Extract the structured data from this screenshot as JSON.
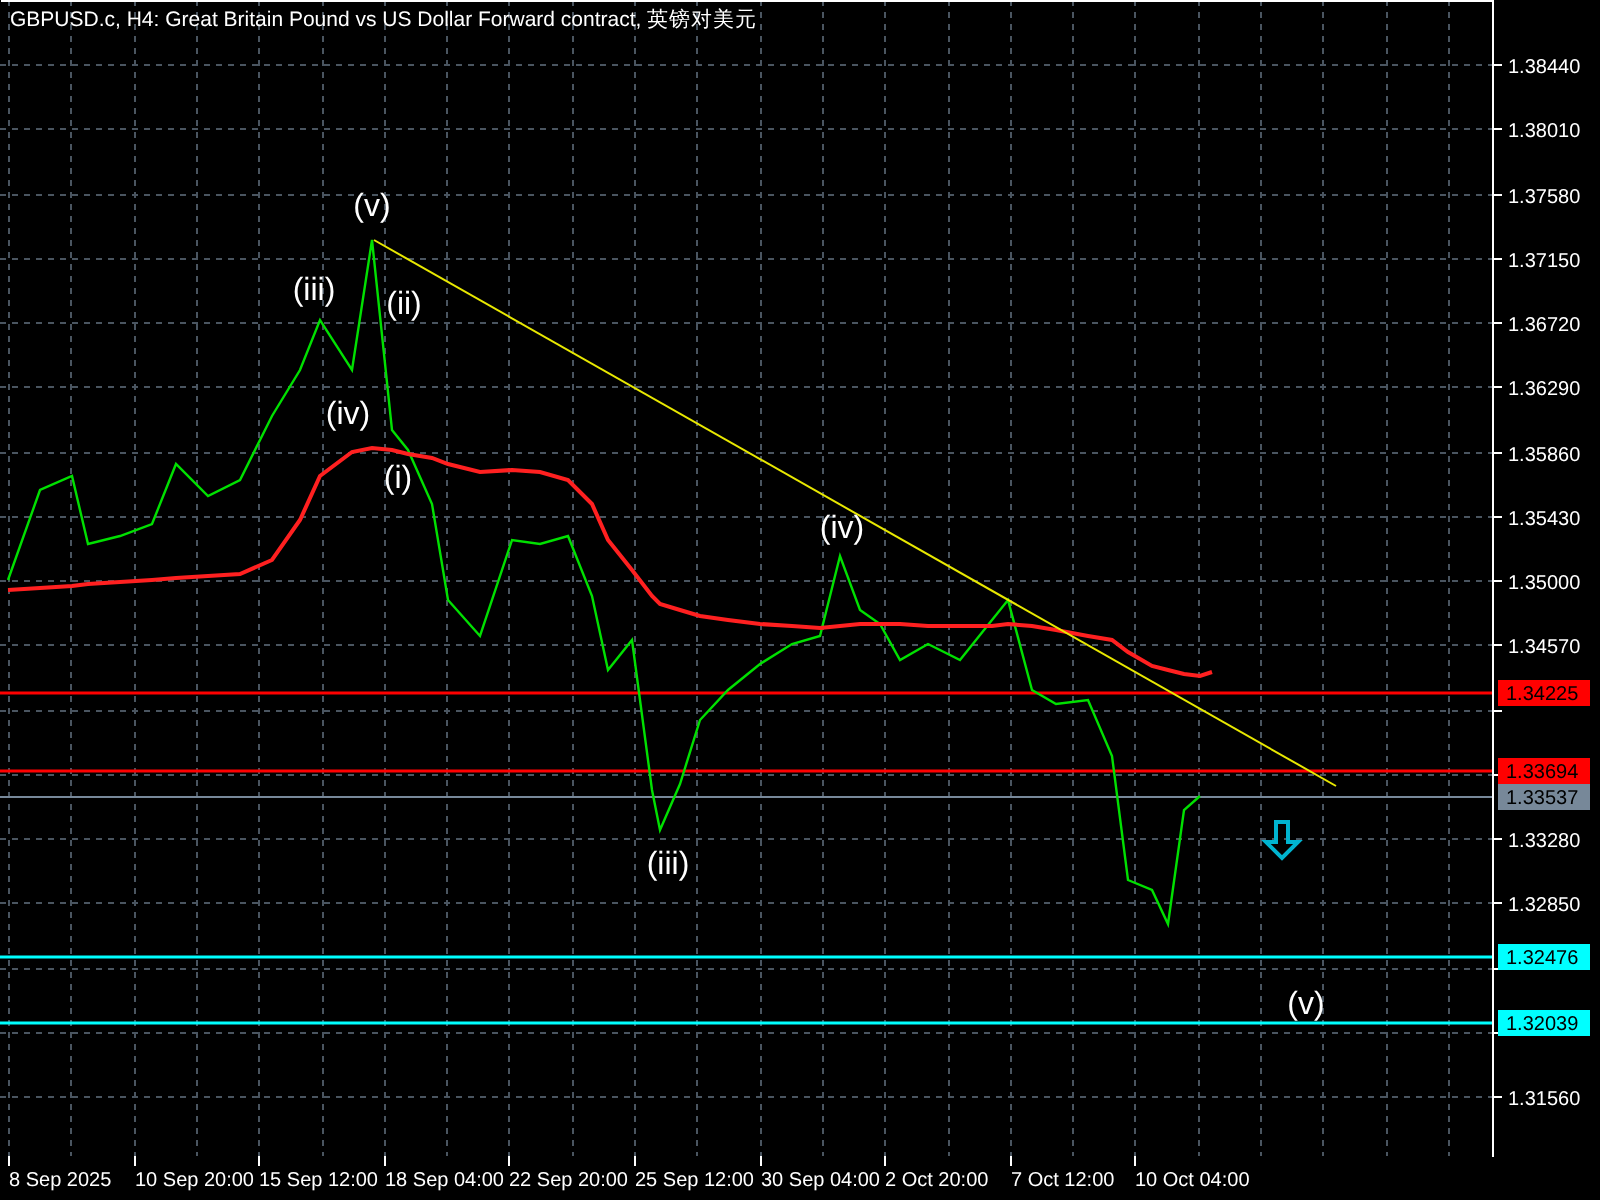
{
  "title": "GBPUSD.c, H4:  Great Britain Pound vs US Dollar Forward contract, 英镑对美元",
  "price_axis": [
    "1.38440",
    "1.38010",
    "1.37580",
    "1.37150",
    "1.36720",
    "1.36290",
    "1.35860",
    "1.35430",
    "1.35000",
    "1.34570",
    "1.33280",
    "1.32850",
    "1.31560"
  ],
  "price_levels": [
    {
      "label": "1.34225",
      "color": "#ff0000"
    },
    {
      "label": "1.33694",
      "color": "#ff0000"
    },
    {
      "label": "1.33537",
      "color": "#778899"
    },
    {
      "label": "1.32476",
      "color": "#00ffff"
    },
    {
      "label": "1.32039",
      "color": "#00ffff"
    }
  ],
  "time_axis": [
    "8 Sep 2025",
    "10 Sep 20:00",
    "15 Sep 12:00",
    "18 Sep 04:00",
    "22 Sep 20:00",
    "25 Sep 12:00",
    "30 Sep 04:00",
    "2 Oct 20:00",
    "7 Oct 12:00",
    "10 Oct 04:00"
  ],
  "wave_labels": [
    "(v)",
    "(iii)",
    "(ii)",
    "(iv)",
    "(i)",
    "(iv)",
    "(iii)",
    "(v)"
  ]
}
